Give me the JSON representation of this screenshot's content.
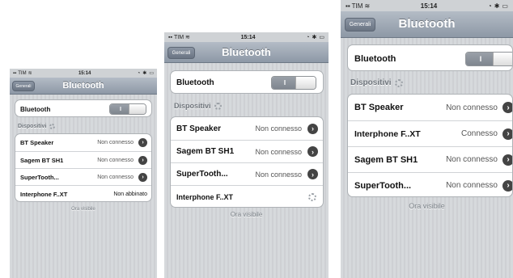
{
  "screens": [
    {
      "statusbar": {
        "carrier": "TIM",
        "time": "15:14"
      },
      "navbar": {
        "back_label": "Generali",
        "title": "Bluetooth"
      },
      "bluetooth_row": {
        "label": "Bluetooth",
        "toggle_text": "I"
      },
      "section_header": "Dispositivi",
      "devices": [
        {
          "name": "BT Speaker",
          "status": "Non connesso"
        },
        {
          "name": "Sagem BT SH1",
          "status": "Non connesso"
        },
        {
          "name": "SuperTooth...",
          "status": "Non connesso"
        },
        {
          "name": "Interphone F..XT",
          "status": "Non abbinato"
        }
      ],
      "footer": "Ora visibile"
    },
    {
      "statusbar": {
        "carrier": "TIM",
        "time": "15:14"
      },
      "navbar": {
        "back_label": "Generali",
        "title": "Bluetooth"
      },
      "bluetooth_row": {
        "label": "Bluetooth",
        "toggle_text": "I"
      },
      "section_header": "Dispositivi",
      "devices": [
        {
          "name": "BT Speaker",
          "status": "Non connesso"
        },
        {
          "name": "Sagem BT SH1",
          "status": "Non connesso"
        },
        {
          "name": "SuperTooth...",
          "status": "Non connesso"
        },
        {
          "name": "Interphone F..XT",
          "status": ""
        }
      ],
      "footer": "Ora visibile"
    },
    {
      "statusbar": {
        "carrier": "TIM",
        "time": "15:14"
      },
      "navbar": {
        "back_label": "Generali",
        "title": "Bluetooth"
      },
      "bluetooth_row": {
        "label": "Bluetooth",
        "toggle_text": "I"
      },
      "section_header": "Dispositivi",
      "devices": [
        {
          "name": "BT Speaker",
          "status": "Non connesso"
        },
        {
          "name": "Interphone F..XT",
          "status": "Connesso"
        },
        {
          "name": "Sagem BT SH1",
          "status": "Non connesso"
        },
        {
          "name": "SuperTooth...",
          "status": "Non connesso"
        }
      ],
      "footer": "Ora visibile"
    }
  ]
}
